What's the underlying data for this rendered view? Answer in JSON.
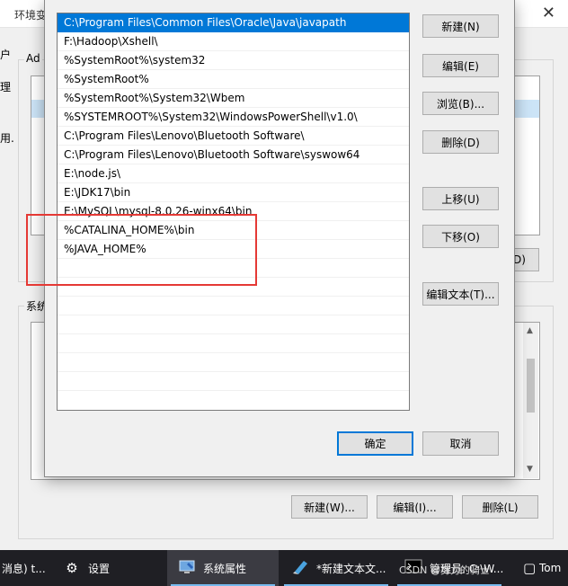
{
  "background_window": {
    "title": "环境变",
    "user_group_label": "Ad",
    "system_group_label": "系统",
    "left_edge_chars": [
      "户",
      "理",
      "用."
    ],
    "buttons": {
      "partial_label": "D)",
      "new": "新建(W)...",
      "edit": "编辑(I)...",
      "delete": "删除(L)"
    }
  },
  "edit_dialog": {
    "paths": [
      "C:\\Program Files\\Common Files\\Oracle\\Java\\javapath",
      "F:\\Hadoop\\Xshell\\",
      "%SystemRoot%\\system32",
      "%SystemRoot%",
      "%SystemRoot%\\System32\\Wbem",
      "%SYSTEMROOT%\\System32\\WindowsPowerShell\\v1.0\\",
      "C:\\Program Files\\Lenovo\\Bluetooth Software\\",
      "C:\\Program Files\\Lenovo\\Bluetooth Software\\syswow64",
      "E:\\node.js\\",
      "E:\\JDK17\\bin",
      "E:\\MySQL\\mysql-8.0.26-winx64\\bin",
      "%CATALINA_HOME%\\bin",
      "%JAVA_HOME%"
    ],
    "selected_index": 0,
    "buttons": {
      "new": "新建(N)",
      "edit": "编辑(E)",
      "browse": "浏览(B)...",
      "delete": "删除(D)",
      "move_up": "上移(U)",
      "move_down": "下移(O)",
      "edit_text": "编辑文本(T)..."
    },
    "ok": "确定",
    "cancel": "取消"
  },
  "taskbar": {
    "items": [
      {
        "label": "消息) t...",
        "icon": "chat-icon"
      },
      {
        "label": "设置",
        "icon": "gear-icon"
      },
      {
        "label": "系统属性",
        "icon": "system-properties-icon"
      },
      {
        "label": "*新建文本文...",
        "icon": "notepad-icon"
      },
      {
        "label": "管理员: C:\\W...",
        "icon": "cmd-icon"
      },
      {
        "label": "Tom",
        "icon": "app-icon"
      }
    ],
    "watermark": "CSDN @努力的骑士"
  }
}
